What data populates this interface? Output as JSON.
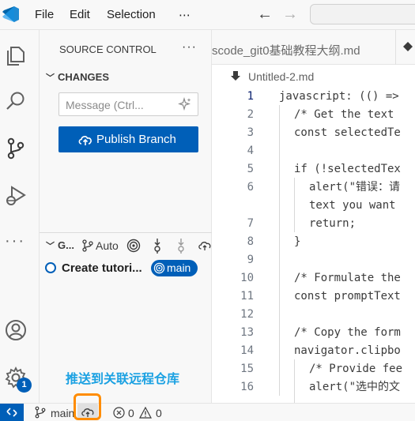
{
  "titlebar": {
    "menus": [
      "File",
      "Edit",
      "Selection",
      "⋯"
    ],
    "back_icon": "arrow-left-icon",
    "forward_icon": "arrow-right-icon"
  },
  "activitybar": {
    "icons": [
      "explorer-icon",
      "search-icon",
      "source-control-icon",
      "run-debug-icon",
      "more-icon",
      "account-icon",
      "settings-gear-icon"
    ],
    "more": "···",
    "settings_badge": "1"
  },
  "sidebar": {
    "title": "SOURCE CONTROL",
    "more": "···",
    "changes_header": "CHANGES",
    "message_placeholder": "Message (Ctrl...",
    "publish_button": "Publish Branch",
    "graph_header": "G...",
    "graph_auto": "Auto",
    "commit_label": "Create tutori...",
    "commit_branch": "main",
    "annotation": "推送到关联远程仓库"
  },
  "editor": {
    "tab_label": "scode_git0基础教程大纲.md",
    "breadcrumb": "Untitled-2.md",
    "lines": [
      {
        "n": "1",
        "text": "javascript: (() =>",
        "indent": 0
      },
      {
        "n": "2",
        "text": "/* Get the text",
        "indent": 1
      },
      {
        "n": "3",
        "text": "const selectedTe",
        "indent": 1
      },
      {
        "n": "4",
        "text": "",
        "indent": 1
      },
      {
        "n": "5",
        "text": "if (!selectedTex",
        "indent": 1
      },
      {
        "n": "6",
        "text": "alert(\"错误：请",
        "indent": 2
      },
      {
        "n": "",
        "text": "text you want",
        "indent": 2
      },
      {
        "n": "7",
        "text": "return;",
        "indent": 2
      },
      {
        "n": "8",
        "text": "}",
        "indent": 1
      },
      {
        "n": "9",
        "text": "",
        "indent": 1
      },
      {
        "n": "10",
        "text": "/* Formulate the",
        "indent": 1
      },
      {
        "n": "11",
        "text": "const promptText",
        "indent": 1
      },
      {
        "n": "12",
        "text": "",
        "indent": 1
      },
      {
        "n": "13",
        "text": "/* Copy the form",
        "indent": 1
      },
      {
        "n": "14",
        "text": "navigator.clipbo",
        "indent": 1
      },
      {
        "n": "15",
        "text": "/* Provide fee",
        "indent": 2
      },
      {
        "n": "16",
        "text": "alert(\"选中的文",
        "indent": 2
      }
    ]
  },
  "statusbar": {
    "branch": "main",
    "errors": "0",
    "warnings": "0"
  },
  "colors": {
    "accent": "#005fb8",
    "annotation": "#1ba1e2",
    "highlight_box": "#ff8c00"
  }
}
